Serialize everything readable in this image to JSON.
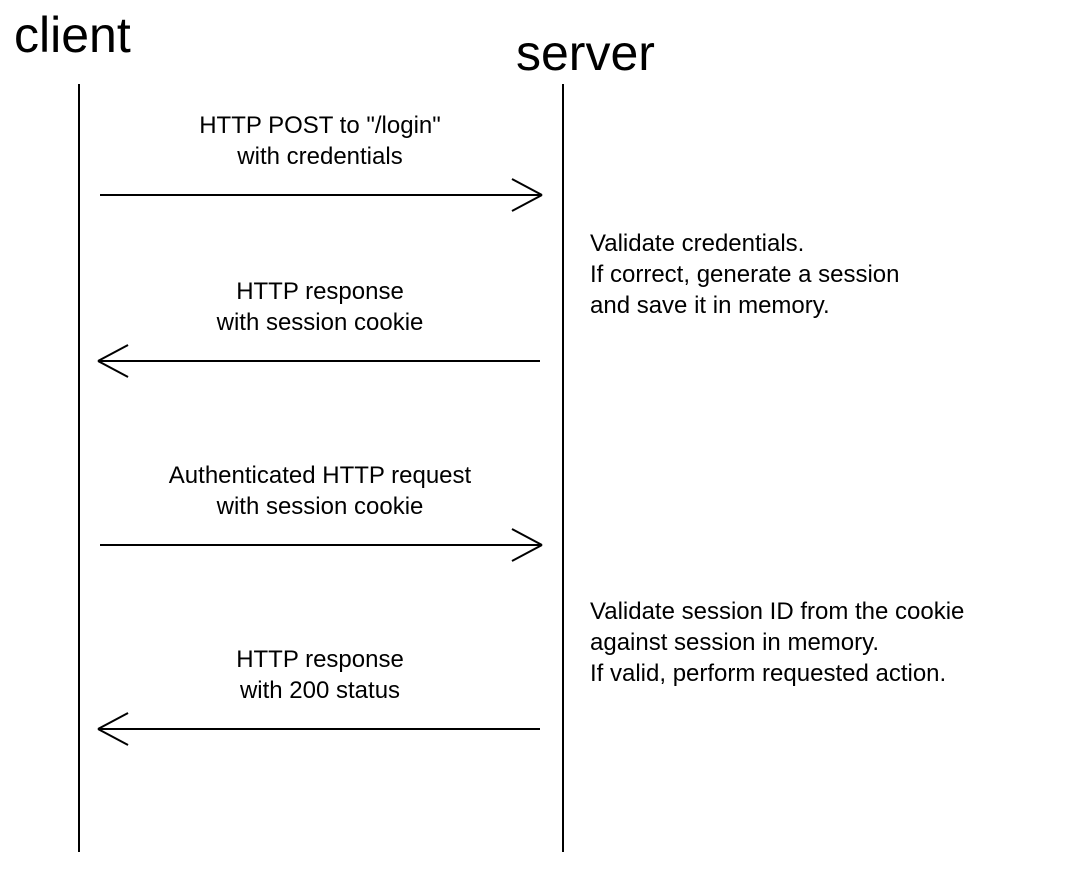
{
  "participants": {
    "client": "client",
    "server": "server"
  },
  "messages": {
    "msg1": "HTTP POST to \"/login\"\nwith credentials",
    "msg2": "HTTP response\nwith session cookie",
    "msg3": "Authenticated HTTP request\nwith session cookie",
    "msg4": "HTTP response\nwith 200 status"
  },
  "notes": {
    "note1": "Validate credentials.\nIf correct, generate a session\nand save it in memory.",
    "note2": "Validate session ID from the cookie\nagainst session in memory.\nIf valid, perform requested action."
  }
}
